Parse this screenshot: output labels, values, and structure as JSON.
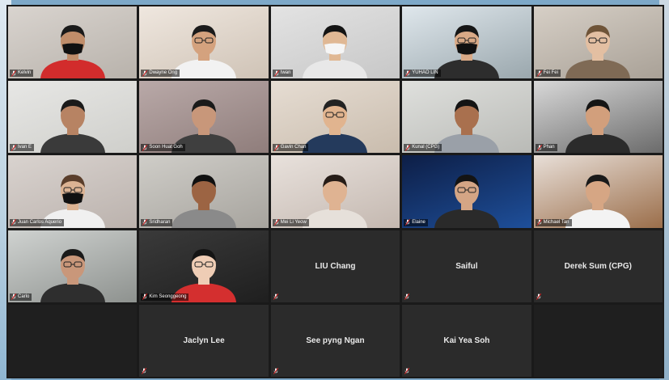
{
  "meeting": {
    "participants": [
      {
        "name": "Kelvin",
        "video": true,
        "bg": [
          "#d9d4cf",
          "#b8b2ab"
        ],
        "skin": "#c08d6a",
        "shirt": "#d22c2c",
        "hair": "#1a1a1a",
        "mask": "#111111"
      },
      {
        "name": "Dwayne Ong",
        "video": true,
        "active": true,
        "bg": [
          "#efe7df",
          "#cfc3b6"
        ],
        "skin": "#d4a27e",
        "shirt": "#f2f2f2",
        "hair": "#1b1b1b",
        "mask": null
      },
      {
        "name": "Iwan",
        "video": true,
        "bg": [
          "#e3e3e3",
          "#c7c7c7"
        ],
        "skin": "#e0b894",
        "shirt": "#e8e8e8",
        "hair": "#141414",
        "mask": "#f5f5f5"
      },
      {
        "name": "YUHAO LIN",
        "video": true,
        "bg": [
          "#dfe7ec",
          "#9aa7ad"
        ],
        "skin": "#d9a986",
        "shirt": "#2d2d2d",
        "hair": "#161616",
        "mask": "#111111"
      },
      {
        "name": "Fei Fei",
        "video": true,
        "bg": [
          "#d6cfc6",
          "#a9a197"
        ],
        "skin": "#e3bfa2",
        "shirt": "#7f6a55",
        "hair": "#6f5438",
        "mask": null
      },
      {
        "name": "Ivan E",
        "video": true,
        "bg": [
          "#e7e7e5",
          "#cfcfcb"
        ],
        "skin": "#b78363",
        "shirt": "#3a3a3a",
        "hair": "#1a1a1a",
        "mask": null
      },
      {
        "name": "Soon Huat Goh",
        "video": true,
        "bg": [
          "#b9a9a8",
          "#8f7d7b"
        ],
        "skin": "#c8977a",
        "shirt": "#3f3f3f",
        "hair": "#1a1a1a",
        "mask": null
      },
      {
        "name": "Gavin Chan",
        "video": true,
        "bg": [
          "#e6ddd3",
          "#c9bcad"
        ],
        "skin": "#e1b48f",
        "shirt": "#243a5c",
        "hair": "#222222",
        "mask": null
      },
      {
        "name": "Kunal (CPG)",
        "video": true,
        "bg": [
          "#dfe0dd",
          "#b9bab6"
        ],
        "skin": "#a9704e",
        "shirt": "#9aa0a8",
        "hair": "#141414",
        "mask": null
      },
      {
        "name": "Phan",
        "video": true,
        "bg": [
          "#d8d8d8",
          "#6b6b6b"
        ],
        "skin": "#d29f7c",
        "shirt": "#2b2b2b",
        "hair": "#151515",
        "mask": null
      },
      {
        "name": "Juan Carlos Aquerio",
        "video": true,
        "bg": [
          "#d9d3cf",
          "#bbb2ad"
        ],
        "skin": "#dcb393",
        "shirt": "#f0f0f0",
        "hair": "#5a3e2b",
        "mask": "#111111"
      },
      {
        "name": "Sridharan",
        "video": true,
        "bg": [
          "#cfcdc8",
          "#a7a49e"
        ],
        "skin": "#9c6443",
        "shirt": "#8a8a8a",
        "hair": "#111111",
        "mask": null
      },
      {
        "name": "Mei Li Yeow",
        "video": true,
        "bg": [
          "#e8e1dc",
          "#c4b8b0"
        ],
        "skin": "#dfb392",
        "shirt": "#e6e0da",
        "hair": "#261c17",
        "mask": null
      },
      {
        "name": "Elaine",
        "video": true,
        "bg": [
          "#0d1e46",
          "#1e4f9a"
        ],
        "skin": "#d4a585",
        "shirt": "#2a2a2a",
        "hair": "#141414",
        "mask": null
      },
      {
        "name": "Michael Tan",
        "video": true,
        "bg": [
          "#e8dfd8",
          "#9b6e4a"
        ],
        "skin": "#d6a684",
        "shirt": "#f3f3f3",
        "hair": "#1a1a1a",
        "mask": null
      },
      {
        "name": "Carlo",
        "video": true,
        "bg": [
          "#cfd2d0",
          "#8e928f"
        ],
        "skin": "#c9977a",
        "shirt": "#2e2e2e",
        "hair": "#1a1a1a",
        "mask": null
      },
      {
        "name": "Kim Seonggeong",
        "video": true,
        "bg": [
          "#3a3a3a",
          "#1f1f1f"
        ],
        "skin": "#efcdb5",
        "shirt": "#d42f2f",
        "hair": "#141414",
        "mask": null
      },
      {
        "name": "LIU Chang",
        "video": false
      },
      {
        "name": "Saiful",
        "video": false
      },
      {
        "name": "Derek Sum (CPG)",
        "video": false
      },
      {
        "name": "",
        "video": false,
        "empty": true
      },
      {
        "name": "Jaclyn Lee",
        "video": false
      },
      {
        "name": "See pyng Ngan",
        "video": false
      },
      {
        "name": "Kai Yea Soh",
        "video": false
      },
      {
        "name": "",
        "video": false,
        "empty": true
      }
    ],
    "colors": {
      "mute_red": "#e02828",
      "active_speaker": "#c9e04a"
    }
  }
}
